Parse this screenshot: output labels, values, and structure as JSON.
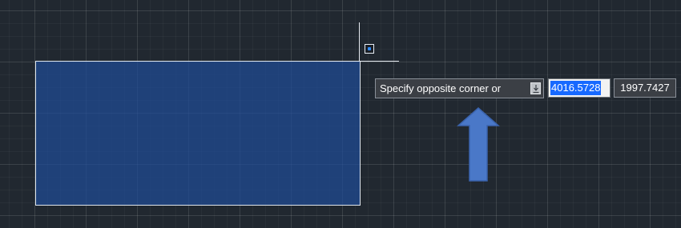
{
  "canvas": {
    "background_color": "#212830",
    "grid": true
  },
  "selection_window": {
    "fill_color": "#1E4B96",
    "border_color": "#dfe6ee"
  },
  "cursor": {
    "crosshair_color": "#e6ebf1",
    "pickbox_dot_color": "#2e8bff"
  },
  "dynamic_input": {
    "prompt": "Specify opposite corner or",
    "options_icon": "down-arrow-icon",
    "x_value": "4016.5728",
    "y_value": "1997.7427",
    "selected_color": "#1769ff"
  },
  "annotation_arrow": {
    "direction": "up",
    "color": "#4a78c8"
  }
}
